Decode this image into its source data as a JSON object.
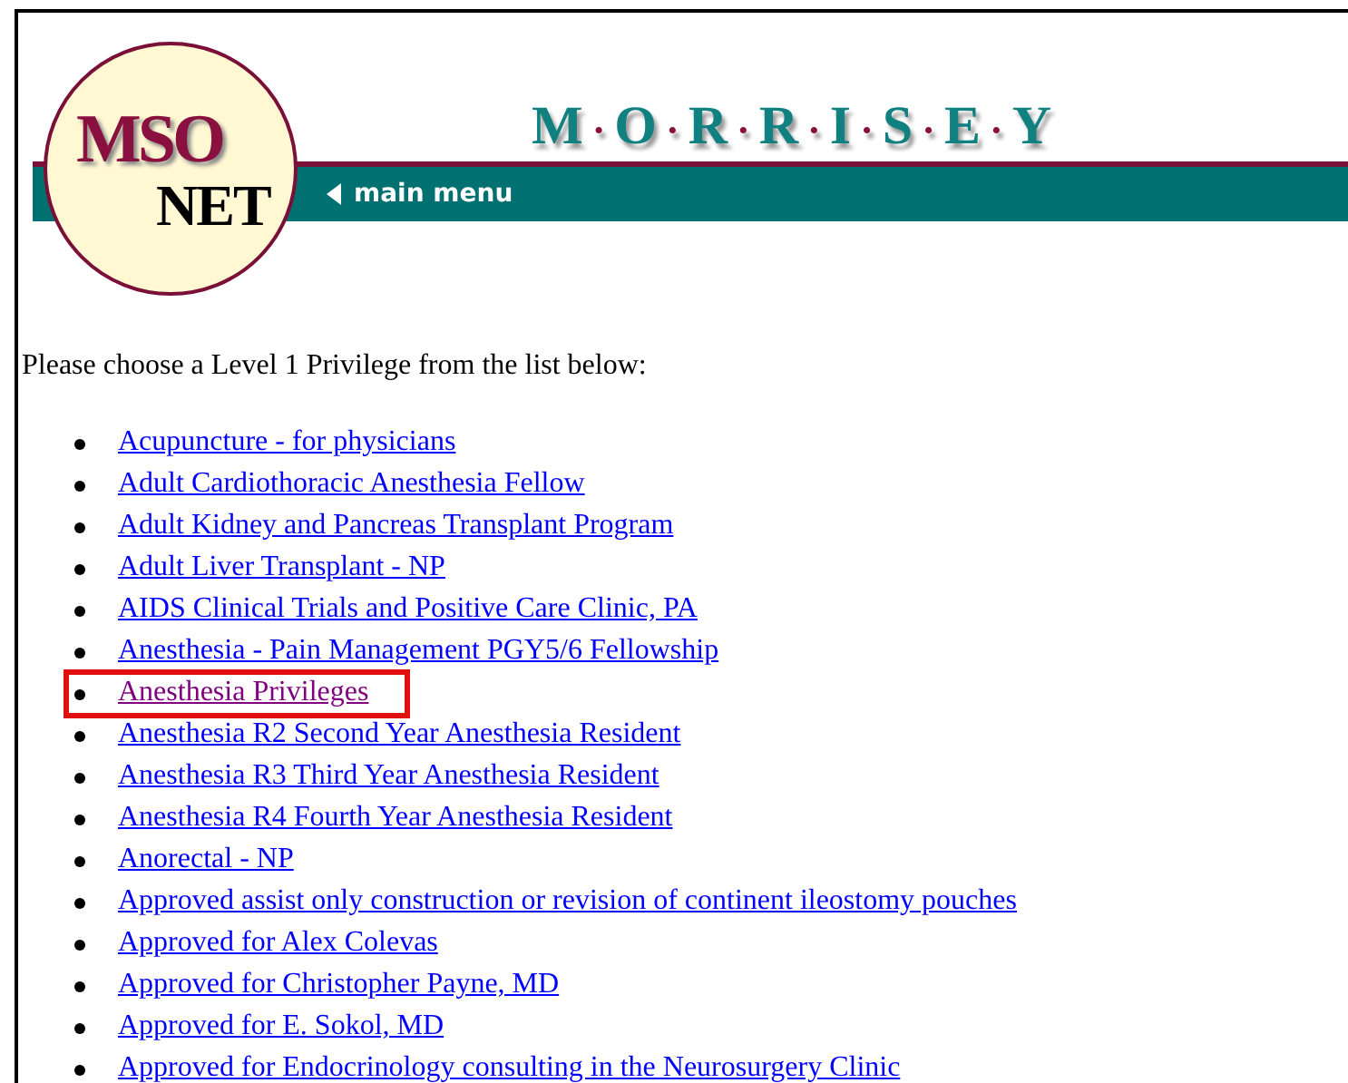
{
  "logo": {
    "top": "MSO",
    "bottom": "NET"
  },
  "banner": {
    "title": "M·O·R·R·I·S·E·Y",
    "nav_link": "main menu"
  },
  "prompt": "Please choose a Level 1 Privilege from the list below:",
  "privileges": [
    {
      "label": "Acupuncture - for physicians",
      "visited": false,
      "highlighted": false
    },
    {
      "label": "Adult Cardiothoracic Anesthesia Fellow",
      "visited": false,
      "highlighted": false
    },
    {
      "label": "Adult Kidney and Pancreas Transplant Program",
      "visited": false,
      "highlighted": false
    },
    {
      "label": "Adult Liver Transplant - NP",
      "visited": false,
      "highlighted": false
    },
    {
      "label": "AIDS Clinical Trials and Positive Care Clinic, PA",
      "visited": false,
      "highlighted": false
    },
    {
      "label": "Anesthesia - Pain Management PGY5/6 Fellowship",
      "visited": false,
      "highlighted": false
    },
    {
      "label": "Anesthesia Privileges",
      "visited": true,
      "highlighted": true
    },
    {
      "label": "Anesthesia R2 Second Year Anesthesia Resident",
      "visited": false,
      "highlighted": false
    },
    {
      "label": "Anesthesia R3 Third Year Anesthesia Resident",
      "visited": false,
      "highlighted": false
    },
    {
      "label": "Anesthesia R4 Fourth Year Anesthesia Resident",
      "visited": false,
      "highlighted": false
    },
    {
      "label": "Anorectal - NP",
      "visited": false,
      "highlighted": false
    },
    {
      "label": "Approved assist only construction or revision of continent ileostomy pouches",
      "visited": false,
      "highlighted": false
    },
    {
      "label": "Approved for Alex Colevas",
      "visited": false,
      "highlighted": false
    },
    {
      "label": "Approved for Christopher Payne, MD",
      "visited": false,
      "highlighted": false
    },
    {
      "label": "Approved for E. Sokol, MD",
      "visited": false,
      "highlighted": false
    },
    {
      "label": "Approved for Endocrinology consulting in the Neurosurgery Clinic",
      "visited": false,
      "highlighted": false
    }
  ]
}
